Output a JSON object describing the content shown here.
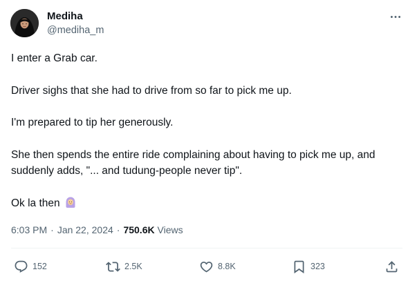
{
  "author": {
    "name": "Mediha",
    "handle": "@mediha_m"
  },
  "tweet": {
    "paragraphs": [
      "I enter a Grab car.",
      "Driver sighs that she had to drive from so far to pick me up.",
      "I'm prepared to tip her generously.",
      "She then spends the entire ride complaining about having to pick me up, and suddenly adds, \"... and tudung-people never tip\".",
      "Ok la then"
    ],
    "emoji": "woman-with-headscarf"
  },
  "meta": {
    "time": "6:03 PM",
    "separator": "·",
    "date": "Jan 22, 2024",
    "views_count": "750.6K",
    "views_label": "Views"
  },
  "actions": {
    "replies": "152",
    "reposts": "2.5K",
    "likes": "8.8K",
    "bookmarks": "323"
  },
  "colors": {
    "text": "#0f1419",
    "secondary": "#536471",
    "divider": "#eff3f4"
  }
}
